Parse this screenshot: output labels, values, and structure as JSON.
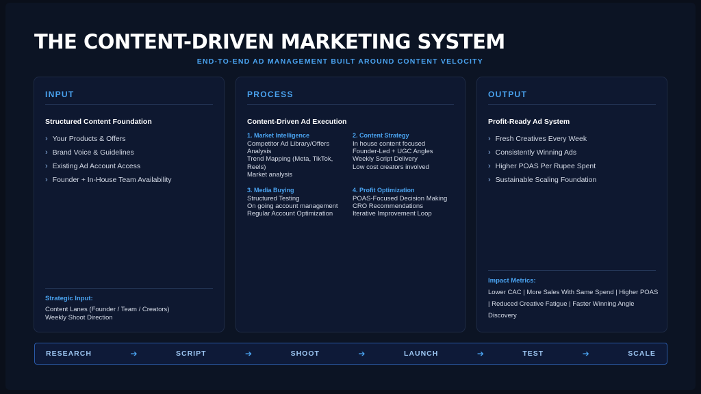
{
  "title": "THE CONTENT-DRIVEN MARKETING SYSTEM",
  "subtitle": "END-TO-END AD MANAGEMENT BUILT AROUND CONTENT VELOCITY",
  "input": {
    "heading": "INPUT",
    "subheading": "Structured Content Foundation",
    "items": [
      "Your Products & Offers",
      "Brand Voice & Guidelines",
      "Existing Ad Account Access",
      "Founder + In-House Team Availability"
    ],
    "footer_title": "Strategic Input:",
    "footer_lines": [
      "Content Lanes (Founder / Team / Creators)",
      "Weekly Shoot Direction"
    ]
  },
  "process": {
    "heading": "PROCESS",
    "subheading": "Content-Driven Ad Execution",
    "blocks": [
      {
        "title": "1. Market Intelligence",
        "lines": [
          "Competitor Ad Library/Offers",
          "Analysis",
          "Trend Mapping (Meta, TikTok,",
          "Reels)",
          "Market analysis"
        ]
      },
      {
        "title": "2. Content Strategy",
        "lines": [
          "In house content focused",
          "Founder-Led + UGC Angles",
          "Weekly Script Delivery",
          "Low cost creators involved"
        ]
      },
      {
        "title": "3. Media Buying",
        "lines": [
          "Structured Testing",
          "On going account management",
          "Regular Account Optimization"
        ]
      },
      {
        "title": "4. Profit Optimization",
        "lines": [
          "POAS-Focused Decision Making",
          "CRO Recommendations",
          "Iterative Improvement Loop"
        ]
      }
    ]
  },
  "output": {
    "heading": "OUTPUT",
    "subheading": "Profit-Ready Ad System",
    "items": [
      "Fresh Creatives Every Week",
      "Consistently Winning Ads",
      "Higher POAS Per Rupee Spent",
      "Sustainable Scaling Foundation"
    ],
    "metrics_title": "Impact Metrics:",
    "metrics_text": "Lower CAC | More Sales With Same Spend | Higher POAS | Reduced Creative Fatigue | Faster Winning Angle Discovery"
  },
  "flow": [
    "RESEARCH",
    "SCRIPT",
    "SHOOT",
    "LAUNCH",
    "TEST",
    "SCALE"
  ],
  "icons": {
    "chevron": "chevron-right-icon",
    "arrow": "arrow-right-icon"
  },
  "colors": {
    "accent": "#4aa3f0",
    "background": "#0c1424",
    "panel": "#0e1830"
  }
}
